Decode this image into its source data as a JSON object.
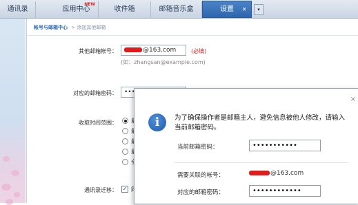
{
  "tabs": [
    {
      "label": "通讯录"
    },
    {
      "label": "应用中心",
      "badge": "NEW"
    },
    {
      "label": "收件箱"
    },
    {
      "label": "邮箱音乐盒"
    },
    {
      "label": "设置",
      "active": true,
      "close": "×"
    }
  ],
  "tab_more_glyph": "▾",
  "breadcrumb": {
    "parent": "帐号与邮箱中心",
    "separator": "> ",
    "current": "添加其他邮箱"
  },
  "form": {
    "other_account_label": "其他邮箱帐号：",
    "other_account_value": "@163.com",
    "required_mark": "(必填)",
    "example_hint": "(如：zhangsan@example.com)",
    "password_label": "对应的邮箱密码：",
    "password_value": "••••••••••••",
    "receive_range_label": "收取时间范围：",
    "radio_prefixes": [
      "最",
      "最",
      "最",
      "最",
      "全"
    ],
    "contacts_migrate_label": "通讯录迁移：",
    "contacts_migrate_checkbox": "✓",
    "contacts_migrate_text": "同"
  },
  "dialog": {
    "close_glyph": "×",
    "icon_glyph": "i",
    "message": "为了确保操作者是邮箱主人，避免信息被他人修改，请输入当前邮箱密码。",
    "current_password_label": "当前邮箱密码：",
    "current_password_value": "•••••••••••",
    "linked_account_label": "需要关联的帐号：",
    "linked_account_value": "@163.com",
    "linked_password_label": "对应的邮箱密码：",
    "linked_password_value": "••••••••••••"
  },
  "colors": {
    "accent": "#2e66ad",
    "required": "#dd2222",
    "redaction": "#e01b1b"
  }
}
